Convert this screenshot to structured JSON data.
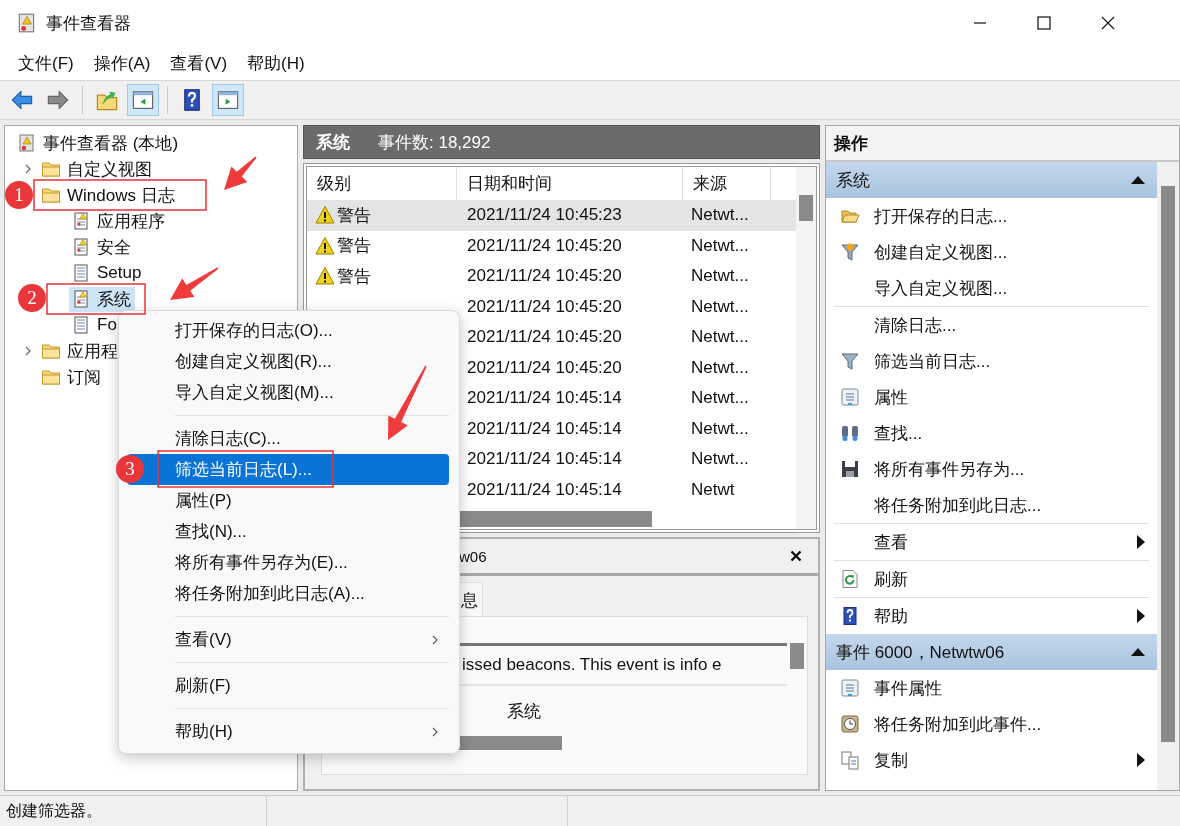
{
  "window": {
    "title": "事件查看器"
  },
  "menu": [
    "文件(F)",
    "操作(A)",
    "查看(V)",
    "帮助(H)"
  ],
  "toolbar": [
    {
      "kind": "back",
      "pressed": false
    },
    {
      "kind": "forward",
      "pressed": false
    },
    {
      "kind": "separator"
    },
    {
      "kind": "up",
      "pressed": false
    },
    {
      "kind": "tree-pane",
      "pressed": true
    },
    {
      "kind": "separator"
    },
    {
      "kind": "help",
      "pressed": false
    },
    {
      "kind": "action-pane",
      "pressed": true
    }
  ],
  "tree": {
    "label": "事件查看器 (本地)",
    "selected": false,
    "children": [
      {
        "label": "自定义视图",
        "expanded": false,
        "selected": false
      },
      {
        "label": "Windows 日志",
        "selected": false,
        "children": [
          {
            "label": "应用程序",
            "selected": false
          },
          {
            "label": "安全",
            "selected": false
          },
          {
            "label": "Setup",
            "selected": false
          },
          {
            "label": "系统",
            "selected": true
          },
          {
            "label": "Fo",
            "selected": false
          }
        ]
      },
      {
        "label": "应用程",
        "expanded": false,
        "selected": false
      },
      {
        "label": "订阅",
        "selected": false
      }
    ]
  },
  "log_header": {
    "name": "系统",
    "count": "事件数: 18,292"
  },
  "table": {
    "columns": [
      "级别",
      "日期和时间",
      "来源"
    ],
    "rows": [
      {
        "level": "警告",
        "datetime": "2021/11/24 10:45:23",
        "source": "Netwt...",
        "selected": true
      },
      {
        "level": "警告",
        "datetime": "2021/11/24 10:45:20",
        "source": "Netwt...",
        "selected": false
      },
      {
        "level": "警告",
        "datetime": "2021/11/24 10:45:20",
        "source": "Netwt...",
        "selected": false
      },
      {
        "datetime": "2021/11/24 10:45:20",
        "source": "Netwt...",
        "selected": false
      },
      {
        "datetime": "2021/11/24 10:45:20",
        "source": "Netwt...",
        "selected": false
      },
      {
        "datetime": "2021/11/24 10:45:20",
        "source": "Netwt...",
        "selected": false
      },
      {
        "datetime": "2021/11/24 10:45:14",
        "source": "Netwt...",
        "selected": false
      },
      {
        "datetime": "2021/11/24 10:45:14",
        "source": "Netwt...",
        "selected": false
      },
      {
        "datetime": "2021/11/24 10:45:14",
        "source": "Netwt...",
        "selected": false
      },
      {
        "datetime": "2021/11/24 10:45:14",
        "source": "Netwt",
        "selected": false
      }
    ]
  },
  "detail": {
    "title": "w06",
    "tab": "息",
    "message": "issed beacons. This event is info e",
    "log_name": "系统"
  },
  "actions": {
    "title": "操作",
    "sections": [
      {
        "title": "系统",
        "expanded": true,
        "items": [
          {
            "kind": "item",
            "label": "打开保存的日志..."
          },
          {
            "kind": "item",
            "label": "创建自定义视图..."
          },
          {
            "kind": "item",
            "label": "导入自定义视图..."
          },
          {
            "kind": "separator"
          },
          {
            "kind": "item",
            "label": "清除日志..."
          },
          {
            "kind": "item",
            "label": "筛选当前日志..."
          },
          {
            "kind": "item",
            "label": "属性"
          },
          {
            "kind": "item",
            "label": "查找..."
          },
          {
            "kind": "item",
            "label": "将所有事件另存为..."
          },
          {
            "kind": "item",
            "label": "将任务附加到此日志..."
          },
          {
            "kind": "separator"
          },
          {
            "kind": "item",
            "label": "查看",
            "submenu": true
          },
          {
            "kind": "separator"
          },
          {
            "kind": "item",
            "label": "刷新"
          },
          {
            "kind": "separator"
          },
          {
            "kind": "item",
            "label": "帮助",
            "submenu": true
          }
        ]
      },
      {
        "title": "事件 6000，Netwtw06",
        "expanded": true,
        "items": [
          {
            "kind": "item",
            "label": "事件属性"
          },
          {
            "kind": "item",
            "label": "将任务附加到此事件..."
          },
          {
            "kind": "item",
            "label": "复制",
            "submenu": true
          }
        ]
      }
    ]
  },
  "context_menu": [
    {
      "kind": "item",
      "label": "打开保存的日志(O)...",
      "selected": false
    },
    {
      "kind": "item",
      "label": "创建自定义视图(R)...",
      "selected": false
    },
    {
      "kind": "item",
      "label": "导入自定义视图(M)...",
      "selected": false
    },
    {
      "kind": "separator"
    },
    {
      "kind": "item",
      "label": "清除日志(C)...",
      "selected": false
    },
    {
      "kind": "item",
      "label": "筛选当前日志(L)...",
      "selected": true
    },
    {
      "kind": "item",
      "label": "属性(P)",
      "selected": false
    },
    {
      "kind": "item",
      "label": "查找(N)...",
      "selected": false
    },
    {
      "kind": "item",
      "label": "将所有事件另存为(E)...",
      "selected": false
    },
    {
      "kind": "item",
      "label": "将任务附加到此日志(A)...",
      "selected": false
    },
    {
      "kind": "separator"
    },
    {
      "kind": "item",
      "label": "查看(V)",
      "selected": false,
      "submenu": true
    },
    {
      "kind": "separator"
    },
    {
      "kind": "item",
      "label": "刷新(F)",
      "selected": false
    },
    {
      "kind": "separator"
    },
    {
      "kind": "item",
      "label": "帮助(H)",
      "selected": false,
      "submenu": true
    }
  ],
  "step_markers": [
    "1",
    "2",
    "3"
  ],
  "status_bar": "创建筛选器。"
}
